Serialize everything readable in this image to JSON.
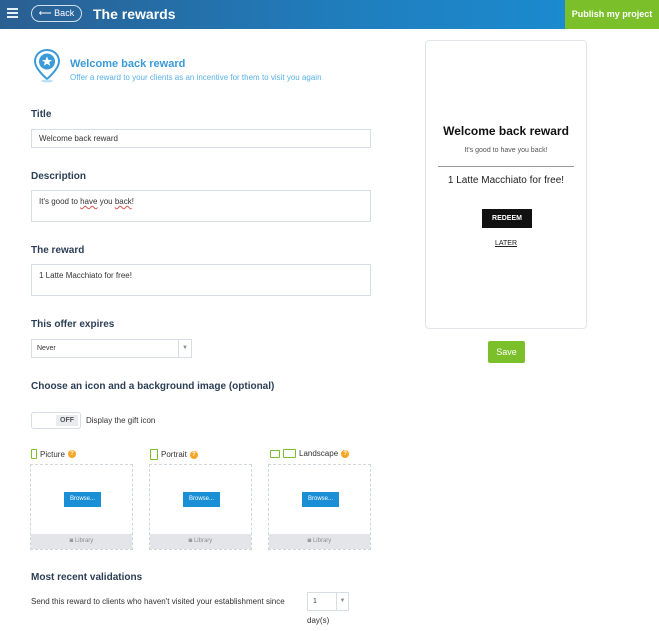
{
  "topbar": {
    "menu_icon": "hamburger-icon",
    "back_label": "⟵ Back",
    "title": "The rewards",
    "publish_label": "Publish my project",
    "colors": {
      "bar": "#1f7fbf",
      "publish": "#7bbf2a"
    }
  },
  "header": {
    "icon": "map-pin-star-icon",
    "title": "Welcome back reward",
    "subtitle": "Offer a reward to your clients as an incentive for them to visit you again"
  },
  "form": {
    "title_label": "Title",
    "title_value": "Welcome back reward",
    "description_label": "Description",
    "description_value": {
      "before": "It's good to ",
      "word1": "have",
      "between": " you ",
      "word2": "back",
      "after": "!"
    },
    "reward_label": "The reward",
    "reward_value": "1 Latte Macchiato for free!",
    "expires_label": "This offer expires",
    "expires_value": "Never",
    "images_label": "Choose an icon and a background image (optional)",
    "toggle_state": "OFF",
    "toggle_label": "Display the gift icon",
    "image_slots": [
      {
        "label": "Picture",
        "browse": "Browse...",
        "library": "Library"
      },
      {
        "label": "Portrait",
        "browse": "Browse...",
        "library": "Library"
      },
      {
        "label": "Landscape",
        "browse": "Browse...",
        "library": "Library"
      }
    ],
    "help_glyph": "?",
    "validations_label": "Most recent validations",
    "validations_text": "Send this reward to clients who haven't visited your establishment since",
    "days_value": "1",
    "days_unit": "day(s)"
  },
  "preview": {
    "title": "Welcome back reward",
    "subtitle": "It's good to have you back!",
    "reward": "1 Latte Macchiato for free!",
    "redeem_label": "REDEEM",
    "later_label": "LATER"
  },
  "save_label": "Save"
}
